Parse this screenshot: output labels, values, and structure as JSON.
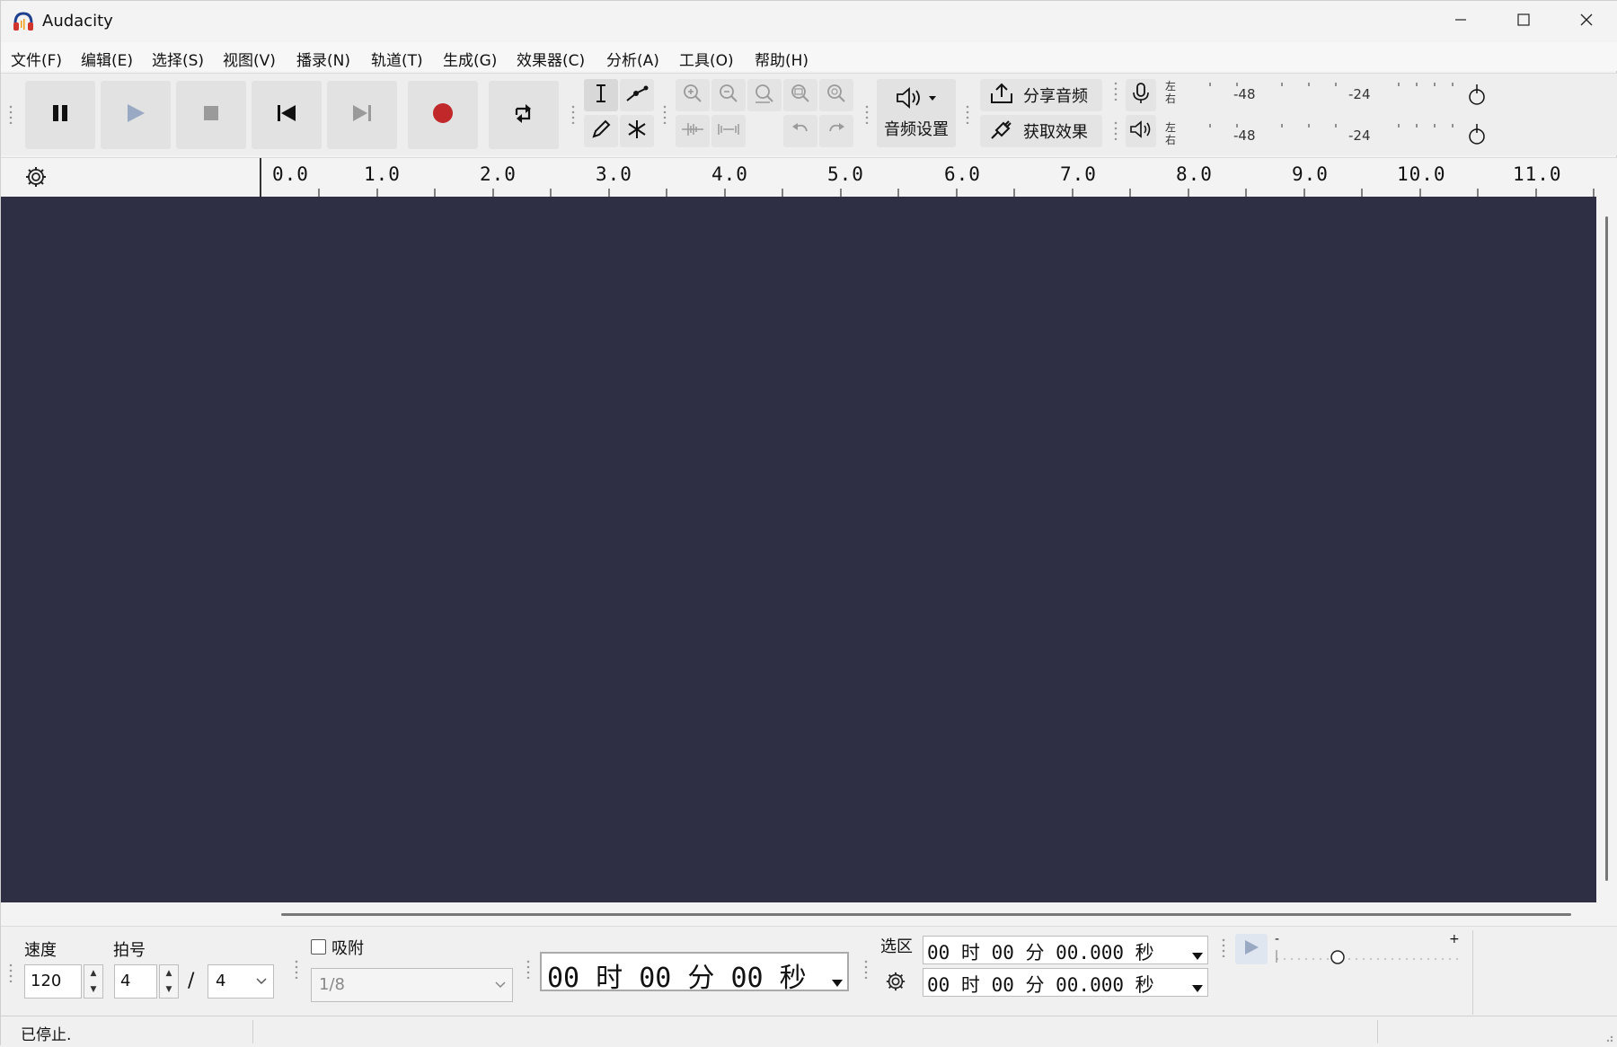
{
  "titlebar": {
    "app_name": "Audacity",
    "icon": "audacity-headphones-icon",
    "controls": [
      "minimize-icon",
      "maximize-icon",
      "close-icon"
    ]
  },
  "menu": {
    "items": [
      "文件(F)",
      "编辑(E)",
      "选择(S)",
      "视图(V)",
      "播录(N)",
      "轨道(T)",
      "生成(G)",
      "效果器(C)",
      "分析(A)",
      "工具(O)",
      "帮助(H)"
    ]
  },
  "toolbar": {
    "transport": [
      "pause-icon",
      "play-icon",
      "stop-icon",
      "skip-to-start-icon",
      "skip-to-end-icon",
      "record-icon",
      "loop-icon"
    ],
    "tools": [
      "selection-tool-icon",
      "envelope-tool-icon",
      "draw-tool-icon",
      "multi-tool-icon"
    ],
    "edit": [
      "zoom-in-icon",
      "zoom-out-icon",
      "fit-selection-icon",
      "fit-project-icon",
      "zoom-toggle-icon",
      "trim-icon",
      "silence-icon",
      "undo-icon",
      "redo-icon"
    ],
    "audio_setup_label": "音频设置",
    "share_audio_label": "分享音频",
    "get_effects_label": "获取效果",
    "meters": {
      "left_label": "左",
      "right_label": "右",
      "tick_a": "-48",
      "tick_b": "-24"
    }
  },
  "ruler": {
    "labels": [
      "0.0",
      "1.0",
      "2.0",
      "3.0",
      "4.0",
      "5.0",
      "6.0",
      "7.0",
      "8.0",
      "9.0",
      "10.0",
      "11.0"
    ]
  },
  "colors": {
    "track_background": "#2e2f44",
    "record_red": "#c0282a",
    "play_disabled": "#9aa9c3"
  },
  "bottom": {
    "tempo_label": "速度",
    "tempo_value": "120",
    "time_sig_label": "拍号",
    "time_sig_numerator": "4",
    "time_sig_slash": "/",
    "time_sig_denominator": "4",
    "snap_label": "吸附",
    "snap_checked": false,
    "snap_value": "1/8",
    "audio_position": "00 时 00 分 00 秒",
    "selection_label": "选区",
    "selection_start": "00 时 00 分 00.000 秒",
    "selection_end": "00 时 00 分 00.000 秒",
    "playback_speed_min": "-",
    "playback_speed_max": "+"
  },
  "status": {
    "text": "已停止."
  }
}
